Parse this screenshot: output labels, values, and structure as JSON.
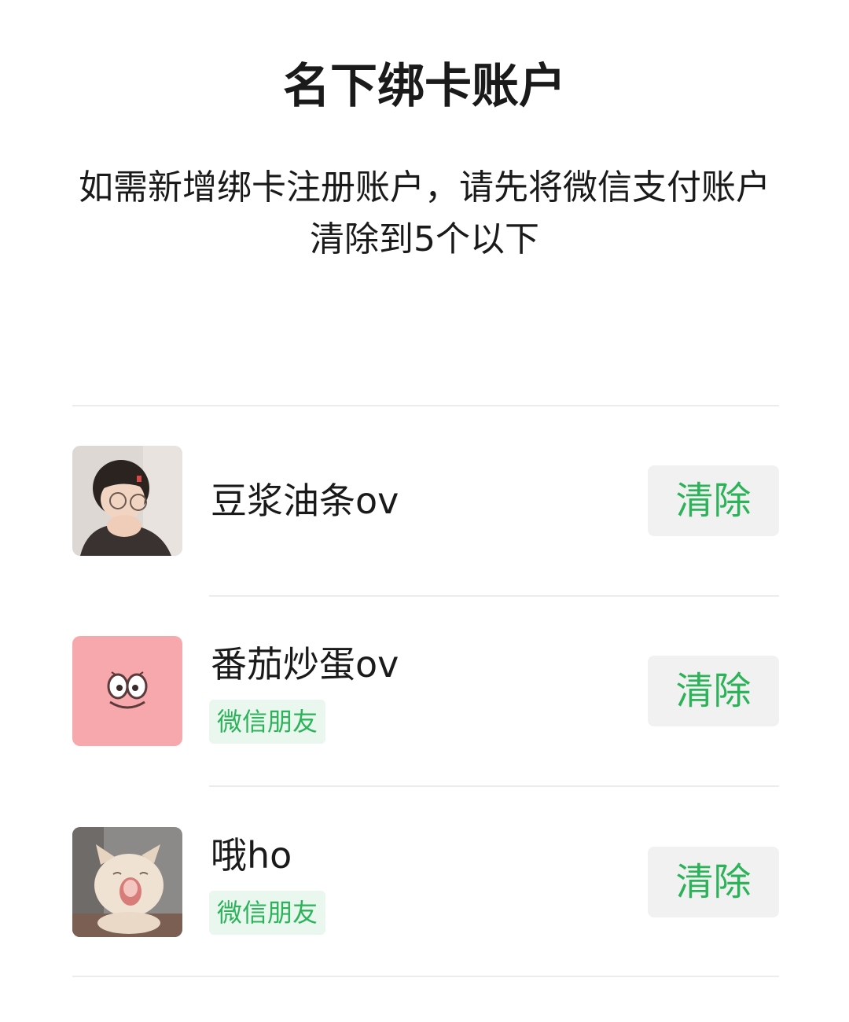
{
  "header": {
    "title": "名下绑卡账户",
    "description": "如需新增绑卡注册账户，请先将微信支付账户清除到5个以下"
  },
  "accounts": [
    {
      "name": "豆浆油条ov",
      "tag": "",
      "action_label": "清除",
      "avatar_icon": "child-photo"
    },
    {
      "name": "番茄炒蛋ov",
      "tag": "微信朋友",
      "action_label": "清除",
      "avatar_icon": "cartoon-star-face"
    },
    {
      "name": "哦ho",
      "tag": "微信朋友",
      "action_label": "清除",
      "avatar_icon": "cat-photo"
    }
  ],
  "colors": {
    "accent_green": "#2cb35a",
    "tag_bg": "#e9f7ee",
    "button_bg": "#f1f1f1",
    "divider": "#ececec"
  }
}
